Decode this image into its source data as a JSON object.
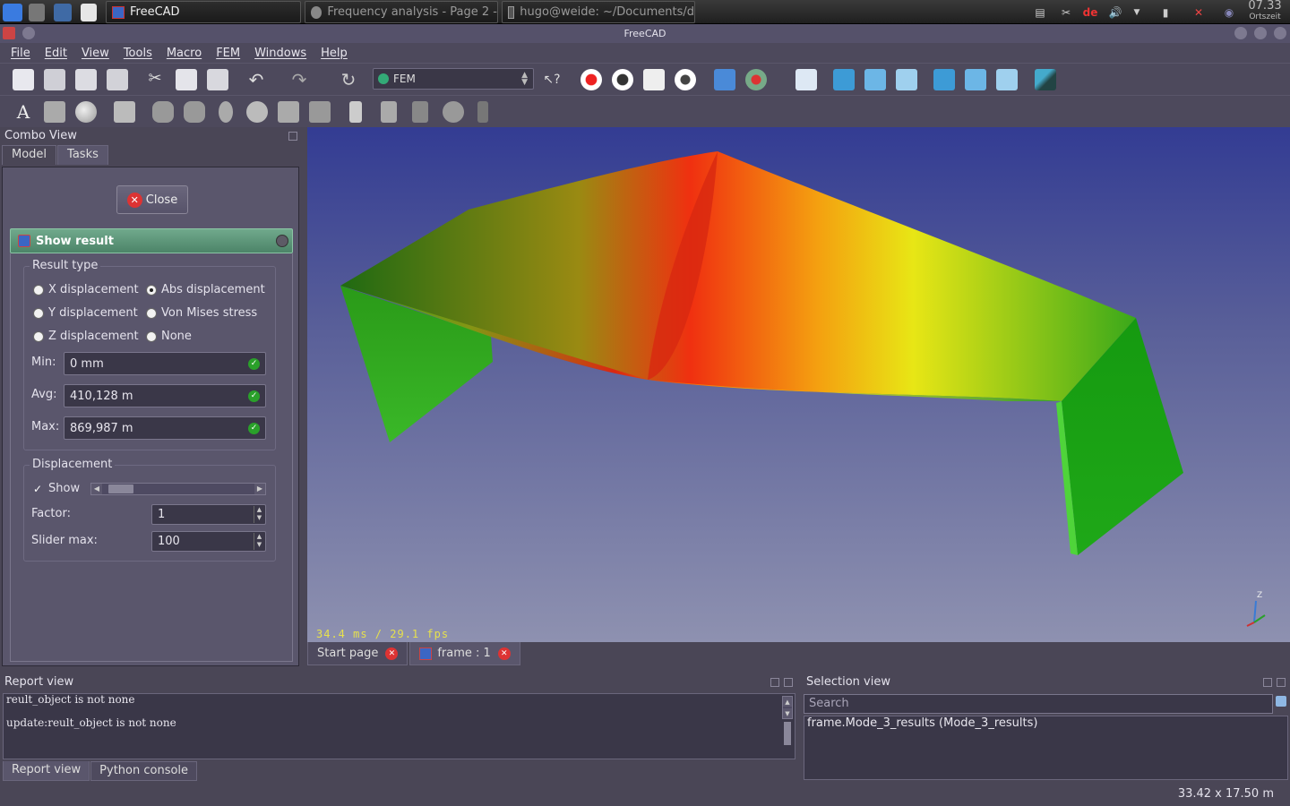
{
  "taskbar": {
    "tasks": [
      {
        "label": "FreeCAD",
        "active": true
      },
      {
        "label": "Frequency analysis - Page 2 -",
        "active": false
      },
      {
        "label": "hugo@weide: ~/Documents/d",
        "active": false
      }
    ],
    "keyboard_layout": "de",
    "clock": {
      "time": "07.33",
      "zone": "Ortszeit"
    }
  },
  "window": {
    "title": "FreeCAD"
  },
  "menu": [
    "File",
    "Edit",
    "View",
    "Tools",
    "Macro",
    "FEM",
    "Windows",
    "Help"
  ],
  "toolbar": {
    "workbench": "FEM"
  },
  "combo_view": {
    "title": "Combo View",
    "tabs": [
      "Model",
      "Tasks"
    ],
    "active_tab": "Tasks",
    "close_label": "Close",
    "show_result": {
      "title": "Show result",
      "result_type": {
        "title": "Result type",
        "options": [
          "X displacement",
          "Abs displacement",
          "Y displacement",
          "Von Mises stress",
          "Z displacement",
          "None"
        ],
        "selected": "Abs displacement"
      },
      "min": {
        "label": "Min:",
        "value": "0 mm"
      },
      "avg": {
        "label": "Avg:",
        "value": "410,128 m"
      },
      "max": {
        "label": "Max:",
        "value": "869,987 m"
      },
      "displacement": {
        "title": "Displacement",
        "show_label": "Show",
        "show_checked": true,
        "slider_level": 0.05,
        "factor_label": "Factor:",
        "factor_value": "1",
        "slider_max_label": "Slider max:",
        "slider_max_value": "100"
      }
    }
  },
  "view3d": {
    "fps_text": "34.4 ms / 29.1 fps",
    "axis_label": "Z",
    "colors": {
      "low": "#22a51c",
      "mid": "#e8e615",
      "high": "#f02010"
    }
  },
  "doc_tabs": [
    {
      "label": "Start page",
      "active": false
    },
    {
      "label": "frame : 1",
      "active": true
    }
  ],
  "report_view": {
    "title": "Report view",
    "lines": [
      "reult_object is not none",
      "update:reult_object is not none"
    ],
    "tabs": [
      "Report view",
      "Python console"
    ]
  },
  "selection_view": {
    "title": "Selection view",
    "search_placeholder": "Search",
    "items": [
      "frame.Mode_3_results (Mode_3_results)"
    ]
  },
  "status": {
    "dimensions": "33.42 x 17.50 m"
  }
}
